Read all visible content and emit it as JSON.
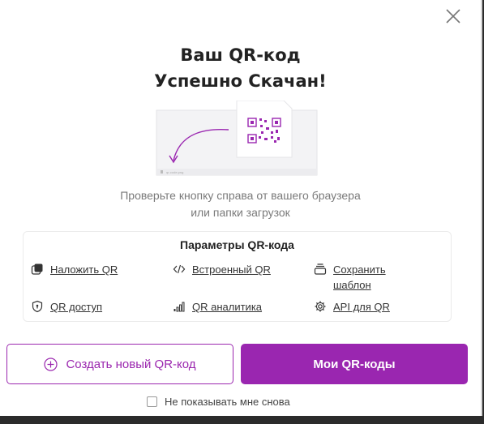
{
  "modal": {
    "title_line1": "Ваш QR-код",
    "title_line2": "Успешно Скачан!",
    "illustration_caption": "qr-code.png",
    "info_line1": "Проверьте кнопку справа от вашего браузера",
    "info_line2": "или папки загрузок"
  },
  "params": {
    "title": "Параметры QR-кода",
    "items": [
      {
        "label": "Наложить QR",
        "icon": "overlay-icon"
      },
      {
        "label": "Встроенный QR",
        "icon": "code-icon"
      },
      {
        "label_line1": "Сохранить",
        "label_line2": "шаблон",
        "icon": "template-icon"
      },
      {
        "label": "QR доступ",
        "icon": "shield-icon"
      },
      {
        "label": "QR аналитика",
        "icon": "bar-chart-icon"
      },
      {
        "label": "API для QR",
        "icon": "gear-icon"
      }
    ]
  },
  "buttons": {
    "create_new": "Создать новый QR-код",
    "my_qr": "Мои QR-коды"
  },
  "dont_show": "Не показывать мне снова",
  "colors": {
    "accent": "#9a26b0",
    "text": "#222222",
    "muted": "#7a7a7a"
  }
}
